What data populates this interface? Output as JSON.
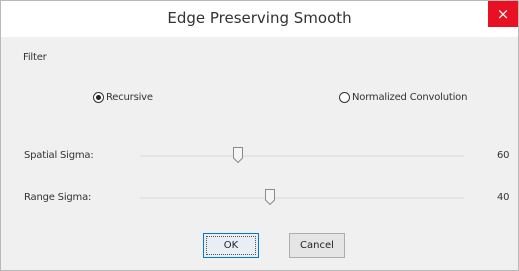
{
  "window": {
    "title": "Edge Preserving Smooth",
    "close_glyph": "×"
  },
  "filter": {
    "group_label": "Filter",
    "options": [
      {
        "label": "Recursive",
        "selected": true
      },
      {
        "label": "Normalized Convolution",
        "selected": false
      }
    ]
  },
  "sliders": {
    "spatial": {
      "label": "Spatial Sigma:",
      "value": "60",
      "position": 0.3
    },
    "range": {
      "label": "Range Sigma:",
      "value": "40",
      "position": 0.4
    }
  },
  "buttons": {
    "ok": "OK",
    "cancel": "Cancel"
  },
  "colors": {
    "close_button": "#e81123",
    "default_button_border": "#0078d7"
  }
}
